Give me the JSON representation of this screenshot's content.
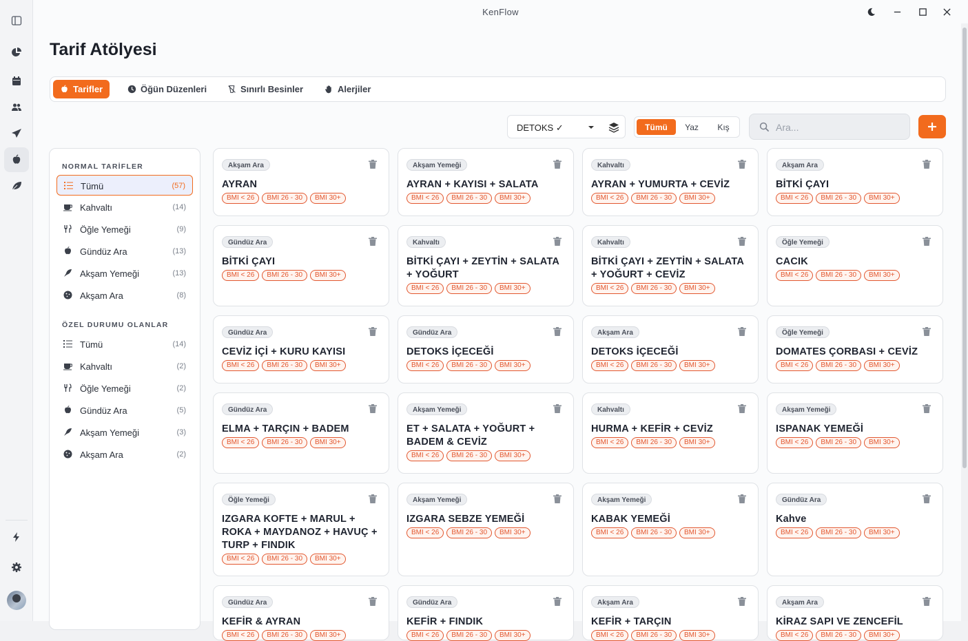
{
  "app_title": "KenFlow",
  "page_title": "Tarif Atölyesi",
  "tabs": [
    {
      "label": "Tarifler",
      "icon": "apple-icon"
    },
    {
      "label": "Öğün Düzenleri",
      "icon": "clock-icon"
    },
    {
      "label": "Sınırlı Besinler",
      "icon": "restricted-icon"
    },
    {
      "label": "Alerjiler",
      "icon": "hand-icon"
    }
  ],
  "filters": {
    "program_select": "DETOKS ✓",
    "seasons": [
      "Tümü",
      "Yaz",
      "Kış"
    ],
    "search_placeholder": "Ara..."
  },
  "sidebar": {
    "section_normal": "NORMAL TARİFLER",
    "section_special": "ÖZEL DURUMU OLANLAR",
    "normal": [
      {
        "label": "Tümü",
        "count": "(57)"
      },
      {
        "label": "Kahvaltı",
        "count": "(14)"
      },
      {
        "label": "Öğle Yemeği",
        "count": "(9)"
      },
      {
        "label": "Gündüz Ara",
        "count": "(13)"
      },
      {
        "label": "Akşam Yemeği",
        "count": "(13)"
      },
      {
        "label": "Akşam Ara",
        "count": "(8)"
      }
    ],
    "special": [
      {
        "label": "Tümü",
        "count": "(14)"
      },
      {
        "label": "Kahvaltı",
        "count": "(2)"
      },
      {
        "label": "Öğle Yemeği",
        "count": "(2)"
      },
      {
        "label": "Gündüz Ara",
        "count": "(5)"
      },
      {
        "label": "Akşam Yemeği",
        "count": "(3)"
      },
      {
        "label": "Akşam Ara",
        "count": "(2)"
      }
    ]
  },
  "bmi_labels": [
    "BMI < 26",
    "BMI 26 - 30",
    "BMI 30+"
  ],
  "recipes": [
    {
      "tag": "Akşam Ara",
      "name": "AYRAN"
    },
    {
      "tag": "Akşam Yemeği",
      "name": "AYRAN + KAYISI + SALATA"
    },
    {
      "tag": "Kahvaltı",
      "name": "AYRAN + YUMURTA + CEVİZ"
    },
    {
      "tag": "Akşam Ara",
      "name": "BİTKİ ÇAYI"
    },
    {
      "tag": "Gündüz Ara",
      "name": "BİTKİ ÇAYI"
    },
    {
      "tag": "Kahvaltı",
      "name": "BİTKİ ÇAYI + ZEYTİN + SALATA + YOĞURT"
    },
    {
      "tag": "Kahvaltı",
      "name": "BİTKİ ÇAYI + ZEYTİN + SALATA + YOĞURT + CEVİZ"
    },
    {
      "tag": "Öğle Yemeği",
      "name": "CACIK"
    },
    {
      "tag": "Gündüz Ara",
      "name": "CEVİZ İÇİ + KURU KAYISI"
    },
    {
      "tag": "Gündüz Ara",
      "name": "DETOKS İÇECEĞİ"
    },
    {
      "tag": "Akşam Ara",
      "name": "DETOKS İÇECEĞİ"
    },
    {
      "tag": "Öğle Yemeği",
      "name": "DOMATES ÇORBASI + CEVİZ"
    },
    {
      "tag": "Gündüz Ara",
      "name": "ELMA + TARÇIN + BADEM"
    },
    {
      "tag": "Akşam Yemeği",
      "name": "ET + SALATA + YOĞURT + BADEM & CEVİZ"
    },
    {
      "tag": "Kahvaltı",
      "name": "HURMA + KEFİR + CEVİZ"
    },
    {
      "tag": "Akşam Yemeği",
      "name": "ISPANAK YEMEĞİ"
    },
    {
      "tag": "Öğle Yemeği",
      "name": "IZGARA KOFTE + MARUL + ROKA + MAYDANOZ + HAVUÇ + TURP + FINDIK"
    },
    {
      "tag": "Akşam Yemeği",
      "name": "IZGARA SEBZE YEMEĞİ"
    },
    {
      "tag": "Akşam Yemeği",
      "name": "KABAK YEMEĞİ"
    },
    {
      "tag": "Gündüz Ara",
      "name": "Kahve"
    },
    {
      "tag": "Gündüz Ara",
      "name": "KEFİR & AYRAN"
    },
    {
      "tag": "Gündüz Ara",
      "name": "KEFİR + FINDIK"
    },
    {
      "tag": "Akşam Ara",
      "name": "KEFİR + TARÇIN"
    },
    {
      "tag": "Akşam Ara",
      "name": "KİRAZ SAPI VE ZENCEFİL"
    }
  ],
  "colors": {
    "accent": "#f26b1d",
    "bmi": "#e2572f"
  }
}
